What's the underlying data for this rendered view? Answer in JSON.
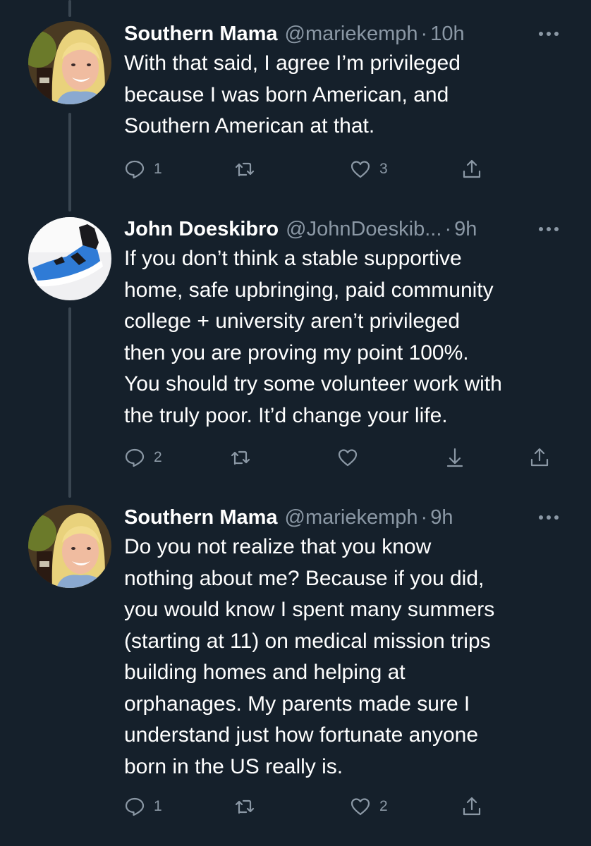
{
  "colors": {
    "background": "#15202b",
    "primary_text": "#ffffff",
    "secondary_text": "#8b98a5",
    "thread_line": "#3a4651"
  },
  "icons": {
    "reply": "reply-icon",
    "retweet": "retweet-icon",
    "like": "heart-icon",
    "share": "share-icon",
    "download": "download-icon",
    "more": "more-icon"
  },
  "tweets": [
    {
      "name": "Southern Mama",
      "handle": "@mariekemph",
      "separator": "·",
      "time": "10h",
      "text": "With that said, I agree I’m privileged\nbecause I was born American, and\nSouthern American at that.",
      "reply_count": "1",
      "like_count": "3"
    },
    {
      "name": "John Doeskibro",
      "handle": "@JohnDoeskib...",
      "separator": "·",
      "time": "9h",
      "text": "If you don’t think a stable supportive\nhome, safe upbringing, paid community\ncollege + university aren’t privileged\nthen you are proving my point 100%.\nYou should try some volunteer work with\nthe truly poor. It’d change your life.",
      "reply_count": "2"
    },
    {
      "name": "Southern Mama",
      "handle": "@mariekemph",
      "separator": "·",
      "time": "9h",
      "text": "Do you not realize that you know\nnothing about me? Because if you did,\nyou would know I spent many summers\n(starting at 11) on medical mission trips\nbuilding homes and helping at\norphanages. My parents made sure I\nunderstand just how fortunate anyone\nborn in the US really is.",
      "reply_count": "1",
      "like_count": "2"
    }
  ]
}
